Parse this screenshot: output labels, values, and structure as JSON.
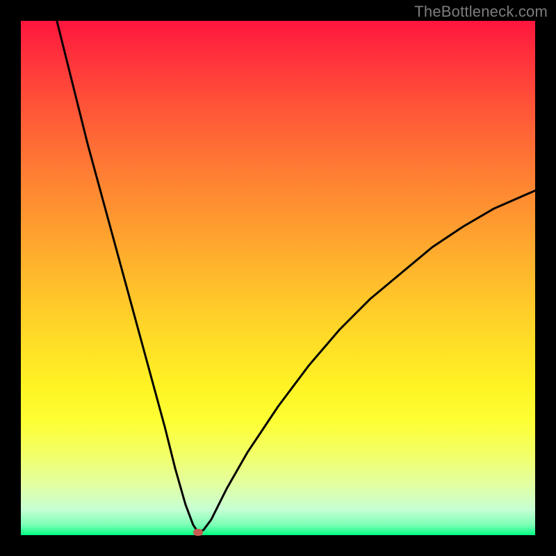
{
  "watermark": "TheBottleneck.com",
  "colors": {
    "frame_bg": "#000000",
    "curve": "#000000",
    "marker": "#c55a50",
    "gradient_top": "#ff153e",
    "gradient_bottom": "#00ff84"
  },
  "chart_data": {
    "type": "line",
    "title": "",
    "xlabel": "",
    "ylabel": "",
    "xlim": [
      0,
      100
    ],
    "ylim": [
      0,
      100
    ],
    "grid": false,
    "series": [
      {
        "name": "bottleneck-curve",
        "x": [
          7,
          10,
          13,
          16,
          19,
          22,
          25,
          28,
          30,
          32,
          33.5,
          34.5,
          35.5,
          37,
          40,
          44,
          50,
          56,
          62,
          68,
          74,
          80,
          86,
          92,
          100
        ],
        "values": [
          100,
          88,
          76,
          65,
          54,
          43,
          32,
          21,
          13,
          6,
          2,
          0.5,
          1,
          3,
          9,
          16,
          25,
          33,
          40,
          46,
          51,
          56,
          60,
          63.5,
          67
        ]
      }
    ],
    "marker": {
      "x": 34.5,
      "y": 0.5,
      "label": "optimal-point"
    }
  }
}
